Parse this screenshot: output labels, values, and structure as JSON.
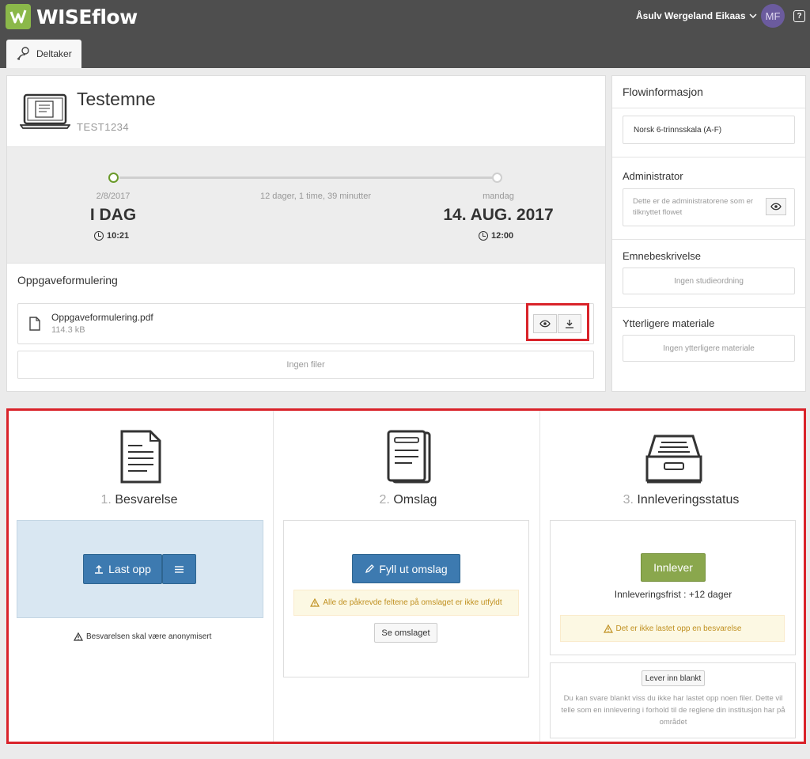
{
  "header": {
    "brand": "WISEflow",
    "user_name": "Åsulv Wergeland Eikaas",
    "avatar_initials": "MF",
    "help_label": "?"
  },
  "tabs": [
    {
      "label": "Deltaker"
    }
  ],
  "course": {
    "title": "Testemne",
    "code": "TEST1234"
  },
  "timeline": {
    "start_date": "2/8/2017",
    "start_label": "I DAG",
    "start_time": "10:21",
    "duration": "12 dager, 1 time, 39 minutter",
    "end_day": "mandag",
    "end_label": "14. AUG. 2017",
    "end_time": "12:00"
  },
  "assignment": {
    "heading": "Oppgaveformulering",
    "file_name": "Oppgaveformulering.pdf",
    "file_size": "114.3 kB",
    "no_files": "Ingen filer"
  },
  "sidebar": {
    "title": "Flowinformasjon",
    "grade_scale": "Norsk 6-trinnsskala (A-F)",
    "admin_label": "Administrator",
    "admin_text": "Dette er de administratorene som er tilknyttet flowet",
    "description_label": "Emnebeskrivelse",
    "description_empty": "Ingen studieordning",
    "material_label": "Ytterligere materiale",
    "material_empty": "Ingen ytterligere materiale"
  },
  "steps": {
    "s1_num": "1.",
    "s1_title": "Besvarelse",
    "s1_upload": "Last opp",
    "s1_note": "Besvarelsen skal være anonymisert",
    "s2_num": "2.",
    "s2_title": "Omslag",
    "s2_fill": "Fyll ut omslag",
    "s2_warning": "Alle de påkrevde feltene på omslaget er ikke utfyldt",
    "s2_view": "Se omslaget",
    "s3_num": "3.",
    "s3_title": "Innleveringsstatus",
    "s3_submit": "Innlever",
    "s3_deadline": "Innleveringsfrist : +12 dager",
    "s3_warning": "Det er ikke lastet opp en besvarelse",
    "s3_blank": "Lever inn blankt",
    "s3_blank_text": "Du kan svare blankt viss du ikke har lastet opp noen filer. Dette vil telle som en innlevering i forhold til de reglene din institusjon har på området"
  },
  "colors": {
    "accent_blue": "#3d7ab0",
    "accent_green": "#8aa74d",
    "highlight_red": "#d9232a",
    "topbar": "#4e4e4e"
  }
}
